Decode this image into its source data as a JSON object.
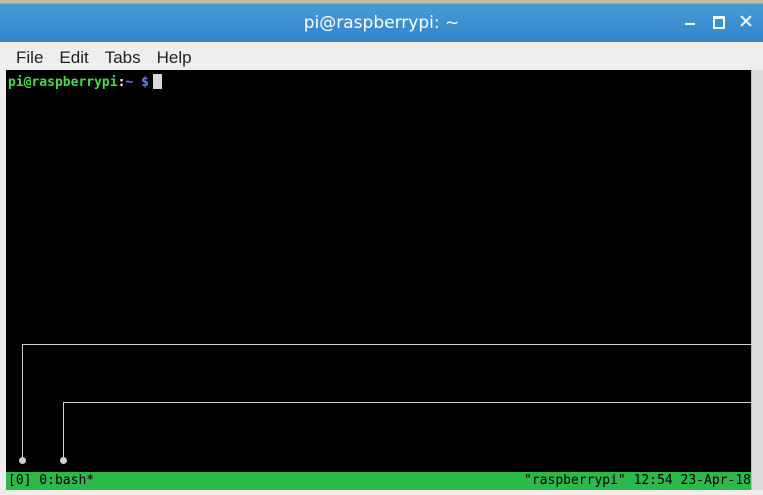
{
  "window": {
    "title": "pi@raspberrypi: ~"
  },
  "menu": {
    "items": [
      "File",
      "Edit",
      "Tabs",
      "Help"
    ]
  },
  "terminal": {
    "prompt_user_host": "pi@raspberrypi",
    "prompt_sep": ":",
    "prompt_path": "~",
    "prompt_symbol": "$"
  },
  "tmux_status": {
    "left": "[0] 0:bash*",
    "right": "\"raspberrypi\" 12:54 23-Apr-18"
  },
  "colors": {
    "titlebar": "#2f86cc",
    "status_bar": "#2db84a",
    "prompt_user": "#4fd64f",
    "prompt_path": "#6a7cff"
  }
}
